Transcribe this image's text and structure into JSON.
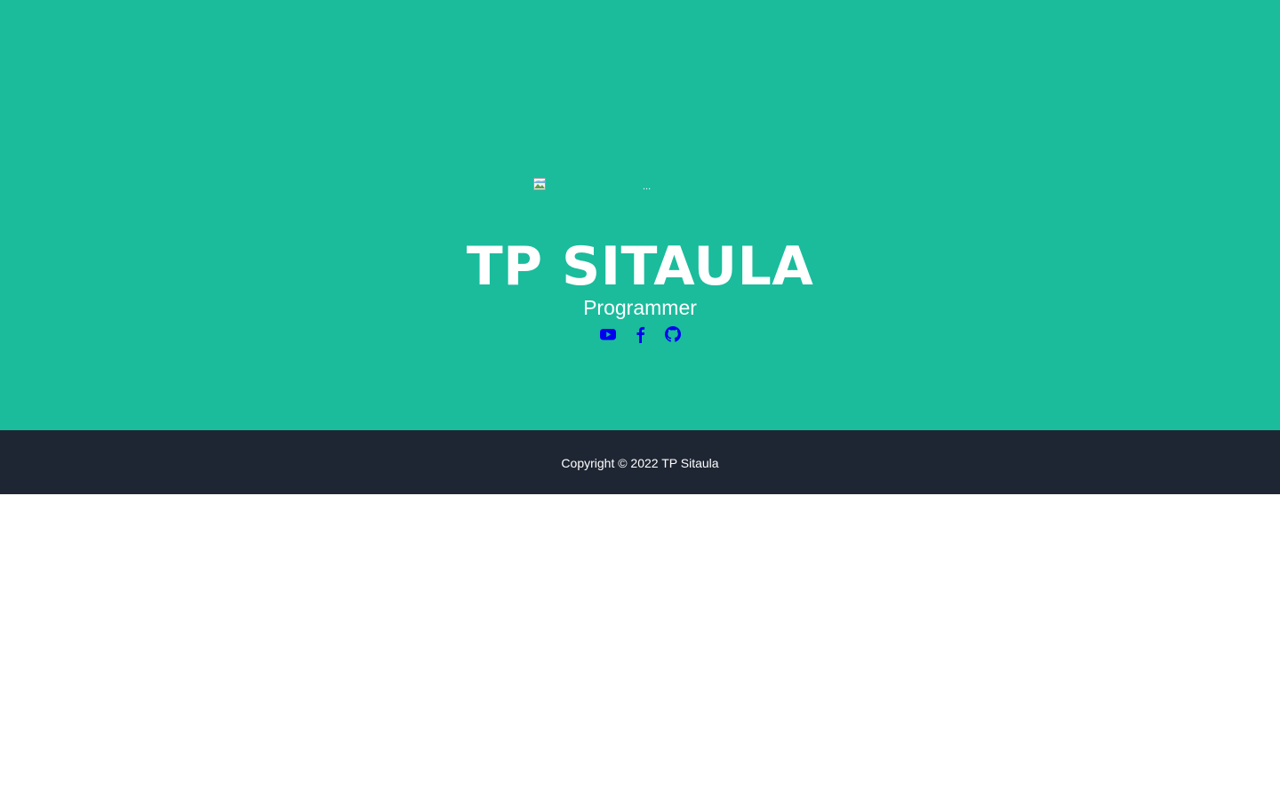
{
  "masthead": {
    "image_alt": "...",
    "title": "TP SITAULA",
    "subtitle": "Programmer",
    "social_links": [
      {
        "name": "youtube",
        "icon": "youtube-icon"
      },
      {
        "name": "facebook",
        "icon": "facebook-icon"
      },
      {
        "name": "github",
        "icon": "github-icon"
      }
    ]
  },
  "footer": {
    "copyright": "Copyright © 2022 TP Sitaula"
  },
  "colors": {
    "masthead_bg": "#1abc9c",
    "footer_bg": "#1f2633",
    "text": "#ffffff",
    "link": "#0000ee"
  }
}
